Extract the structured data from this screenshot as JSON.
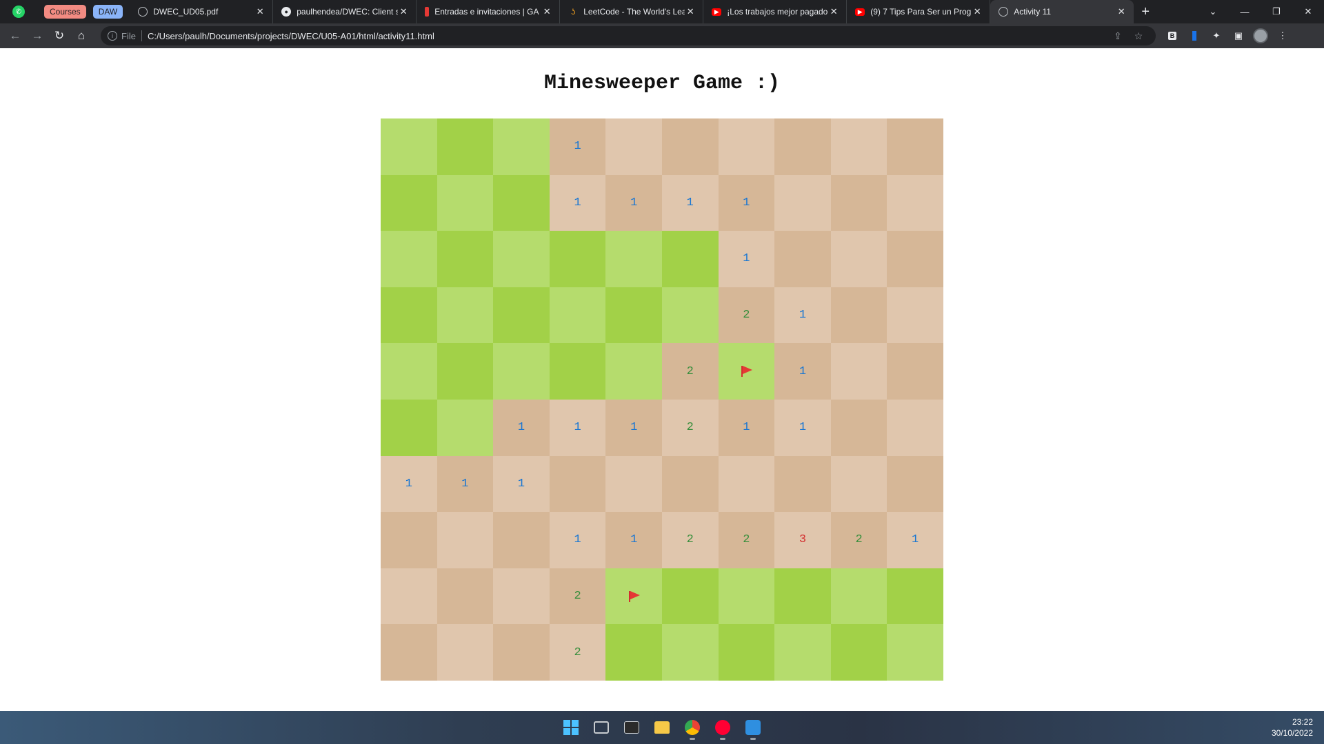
{
  "browser": {
    "group_chips": [
      {
        "label": "Courses",
        "color": "#f28b82"
      },
      {
        "label": "DAW",
        "color": "#8ab4f8"
      }
    ],
    "tabs": [
      {
        "title": "DWEC_UD05.pdf",
        "icon": "globe-icon",
        "color": "#5f6368"
      },
      {
        "title": "paulhendea/DWEC: Client s",
        "icon": "github-icon",
        "color": "#e8eaed"
      },
      {
        "title": "Entradas e invitaciones | GA",
        "icon": "ticket-icon",
        "color": "#e53935"
      },
      {
        "title": "LeetCode - The World's Lea",
        "icon": "leetcode-icon",
        "color": "#f0a020"
      },
      {
        "title": "¡Los trabajos mejor pagado",
        "icon": "youtube-icon",
        "color": "#ff0000"
      },
      {
        "title": "(9) 7 Tips Para Ser un Progr",
        "icon": "youtube-icon",
        "color": "#ff0000"
      },
      {
        "title": "Activity 11",
        "icon": "globe-icon",
        "color": "#5f6368",
        "active": true
      }
    ],
    "url": "C:/Users/paulh/Documents/projects/DWEC/U05-A01/html/activity11.html",
    "url_scheme_label": "File"
  },
  "page": {
    "title": "Minesweeper Game :)"
  },
  "board": {
    "colors": {
      "green_light": "#b5dc6d",
      "green_dark": "#a2d148",
      "tan_light": "#e0c6ad",
      "tan_dark": "#d6b797"
    },
    "rows": [
      [
        "g",
        "g",
        "g",
        "1",
        " ",
        " ",
        " ",
        " ",
        " ",
        " "
      ],
      [
        "g",
        "g",
        "g",
        "1",
        "1",
        "1",
        "1",
        " ",
        " ",
        " "
      ],
      [
        "g",
        "g",
        "g",
        "g",
        "g",
        "g",
        "1",
        " ",
        " ",
        " "
      ],
      [
        "g",
        "g",
        "g",
        "g",
        "g",
        "g",
        "2",
        "1",
        " ",
        " "
      ],
      [
        "g",
        "g",
        "g",
        "g",
        "g",
        "2",
        "F",
        "1",
        " ",
        " "
      ],
      [
        "g",
        "g",
        "1",
        "1",
        "1",
        "2",
        "1",
        "1",
        " ",
        " "
      ],
      [
        "1",
        "1",
        "1",
        " ",
        " ",
        " ",
        " ",
        " ",
        " ",
        " "
      ],
      [
        " ",
        " ",
        " ",
        "1",
        "1",
        "2",
        "2",
        "3",
        "2",
        "1"
      ],
      [
        " ",
        " ",
        " ",
        "2",
        "F",
        "g",
        "g",
        "g",
        "g",
        "g"
      ],
      [
        " ",
        " ",
        " ",
        "2",
        "g",
        "g",
        "g",
        "g",
        "g",
        "g"
      ]
    ]
  },
  "taskbar": {
    "apps": [
      {
        "name": "start-icon",
        "color": "#4cc2ff"
      },
      {
        "name": "task-view-icon",
        "color": "#c8ccd0"
      },
      {
        "name": "terminal-icon",
        "color": "#cfd3d7"
      },
      {
        "name": "file-explorer-icon",
        "color": "#f7c948"
      },
      {
        "name": "chrome-icon",
        "color": "#34a853",
        "running": true
      },
      {
        "name": "youtube-music-icon",
        "color": "#ff0033",
        "running": true
      },
      {
        "name": "vscode-icon",
        "color": "#2f8fe0",
        "running": true
      }
    ],
    "time": "23:22",
    "date": "30/10/2022"
  }
}
